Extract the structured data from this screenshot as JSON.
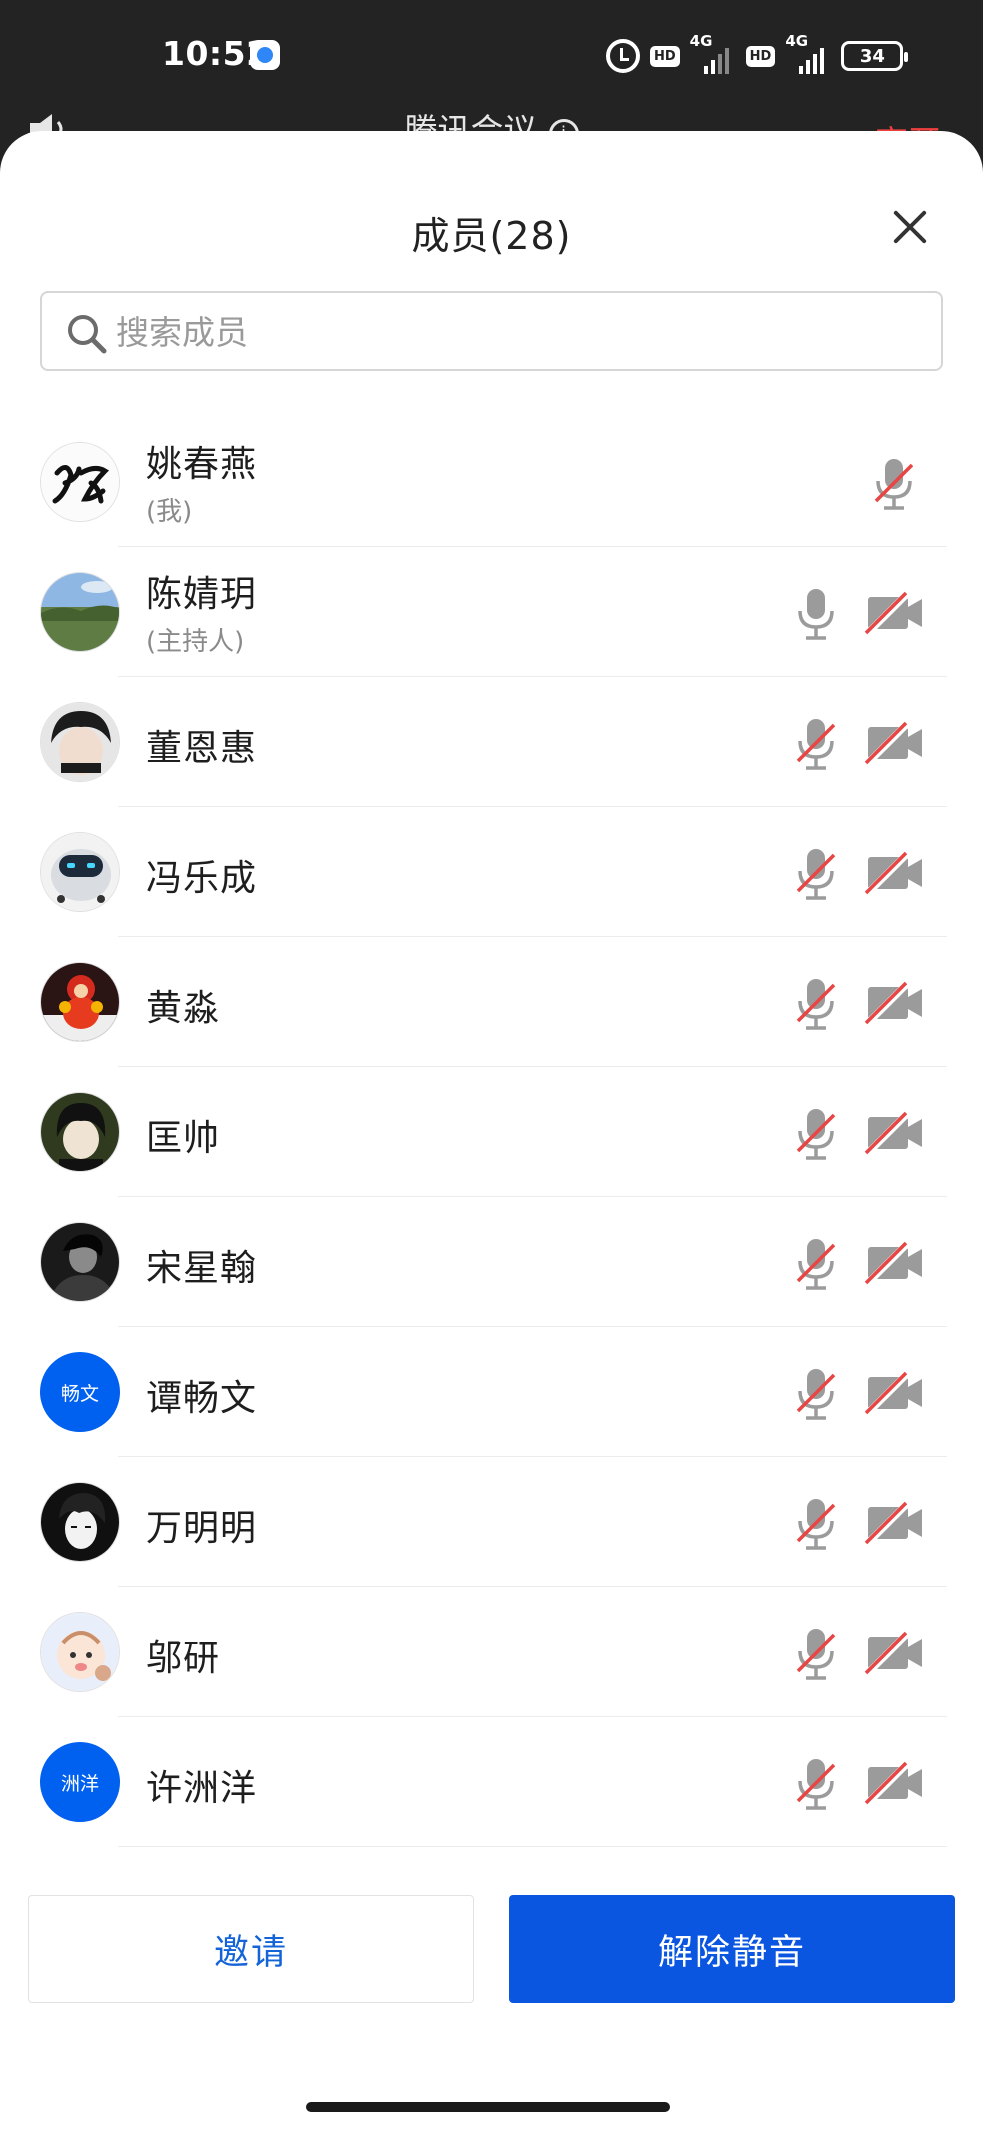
{
  "status_bar": {
    "time": "10:52",
    "hd_1": "HD",
    "net_1": "4G",
    "hd_2": "HD",
    "net_2": "4G",
    "battery": "34"
  },
  "meeting": {
    "title": "腾讯会议",
    "leave": "离开"
  },
  "panel": {
    "title": "成员(28)"
  },
  "search": {
    "placeholder": "搜索成员"
  },
  "members": [
    {
      "name": "姚春燕",
      "role": "(我)",
      "mic": "muted",
      "camera": "none"
    },
    {
      "name": "陈婧玥",
      "role": "(主持人)",
      "mic": "on",
      "camera": "off"
    },
    {
      "name": "董恩惠",
      "mic": "muted",
      "camera": "off"
    },
    {
      "name": "冯乐成",
      "mic": "muted",
      "camera": "off"
    },
    {
      "name": "黄淼",
      "mic": "muted",
      "camera": "off"
    },
    {
      "name": "匡帅",
      "mic": "muted",
      "camera": "off"
    },
    {
      "name": "宋星翰",
      "mic": "muted",
      "camera": "off"
    },
    {
      "name": "谭畅文",
      "avatar_text": "畅文",
      "mic": "muted",
      "camera": "off"
    },
    {
      "name": "万明明",
      "mic": "muted",
      "camera": "off"
    },
    {
      "name": "邬研",
      "mic": "muted",
      "camera": "off"
    },
    {
      "name": "许洲洋",
      "avatar_text": "洲洋",
      "mic": "muted",
      "camera": "off"
    }
  ],
  "buttons": {
    "invite": "邀请",
    "unmute": "解除静音"
  },
  "colors": {
    "accent": "#0a56e0",
    "mute_slash": "#e84545",
    "leave": "#f04040"
  }
}
